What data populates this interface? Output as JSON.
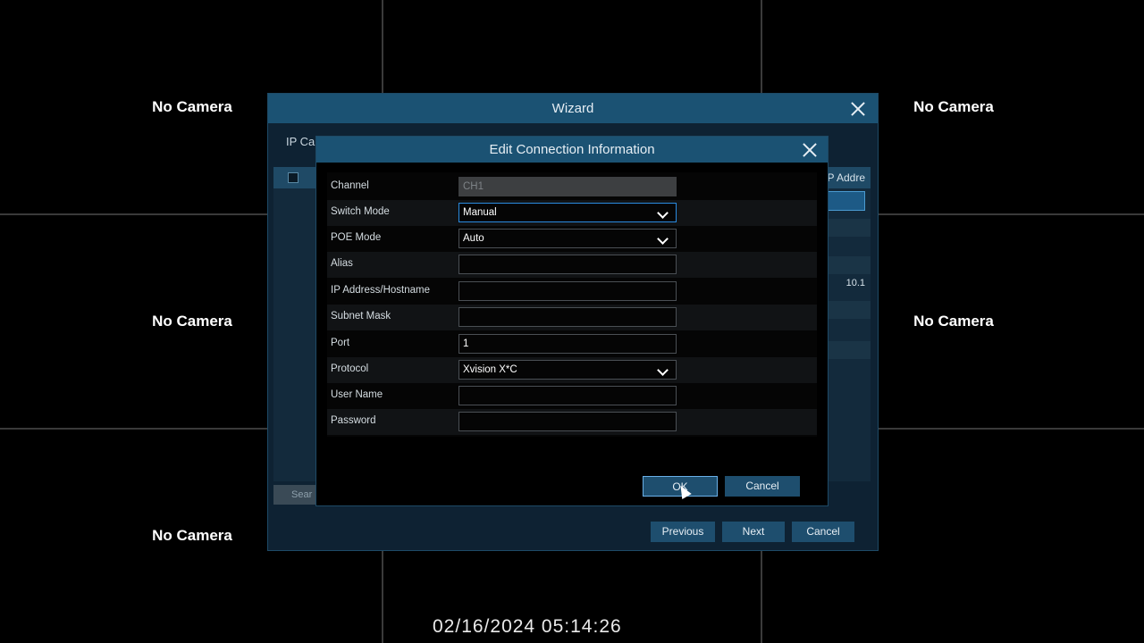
{
  "camera_grid": {
    "no_camera_label": "No Camera"
  },
  "wizard": {
    "title": "Wizard",
    "tab_label": "IP Ca",
    "table": {
      "ip_column_header": "P Addre",
      "ip_value": "10.1"
    },
    "search_label": "Sear",
    "buttons": {
      "previous": "Previous",
      "next": "Next",
      "cancel": "Cancel"
    }
  },
  "dialog": {
    "title": "Edit Connection Information",
    "fields": {
      "channel": {
        "label": "Channel",
        "value": "CH1"
      },
      "switch_mode": {
        "label": "Switch Mode",
        "value": "Manual"
      },
      "poe_mode": {
        "label": "POE Mode",
        "value": "Auto"
      },
      "alias": {
        "label": "Alias",
        "value": ""
      },
      "ip_address": {
        "label": "IP Address/Hostname",
        "value": ""
      },
      "subnet_mask": {
        "label": "Subnet Mask",
        "value": ""
      },
      "port": {
        "label": "Port",
        "value": "1"
      },
      "protocol": {
        "label": "Protocol",
        "value": "Xvision X*C"
      },
      "user_name": {
        "label": "User Name",
        "value": ""
      },
      "password": {
        "label": "Password",
        "value": ""
      }
    },
    "buttons": {
      "ok": "OK",
      "cancel": "Cancel"
    }
  },
  "timestamp": "02/16/2024 05:14:26",
  "colors": {
    "title_bar": "#1b5273",
    "button": "#1e4e6e",
    "focus": "#2a8be0"
  }
}
